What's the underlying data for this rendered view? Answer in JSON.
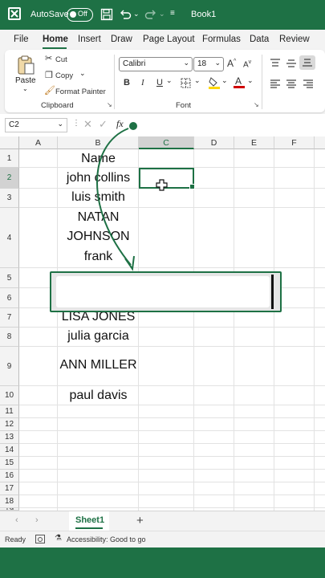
{
  "titlebar": {
    "autosave_label": "AutoSave",
    "autosave_state": "Off",
    "book_title": "Book1",
    "accent": "#1e7145"
  },
  "menu": {
    "tabs": [
      "File",
      "Home",
      "Insert",
      "Draw",
      "Page Layout",
      "Formulas",
      "Data",
      "Review"
    ],
    "active": "Home"
  },
  "ribbon": {
    "paste": "Paste",
    "cut": "Cut",
    "copy": "Copy",
    "format_painter": "Format Painter",
    "clipboard_group": "Clipboard",
    "font_name": "Calibri",
    "font_size": "18",
    "font_group": "Font",
    "bold": "B",
    "italic": "I",
    "underline": "U",
    "fx": "fx"
  },
  "formula": {
    "name_box": "C2",
    "value": ""
  },
  "columns": [
    "A",
    "B",
    "C",
    "D",
    "E",
    "F"
  ],
  "selected_column": "C",
  "rows": [
    "1",
    "2",
    "3",
    "4",
    "5",
    "6",
    "7",
    "8",
    "9",
    "10",
    "11",
    "12",
    "13",
    "14",
    "15",
    "16",
    "17",
    "18",
    "19"
  ],
  "selected_row": "2",
  "cells": {
    "B1": "Name",
    "B2": "john collins",
    "B3": "luis smith",
    "B4a": "NATAN",
    "B4b": "JOHNSON",
    "B4c": "frank",
    "B7": "LISA JONES",
    "B8": "julia garcia",
    "B9": "ANN MILLER",
    "B10": "paul davis"
  },
  "sheets": {
    "tabs": [
      "Sheet1"
    ],
    "add": "+"
  },
  "status": {
    "ready": "Ready",
    "accessibility": "Accessibility: Good to go"
  }
}
